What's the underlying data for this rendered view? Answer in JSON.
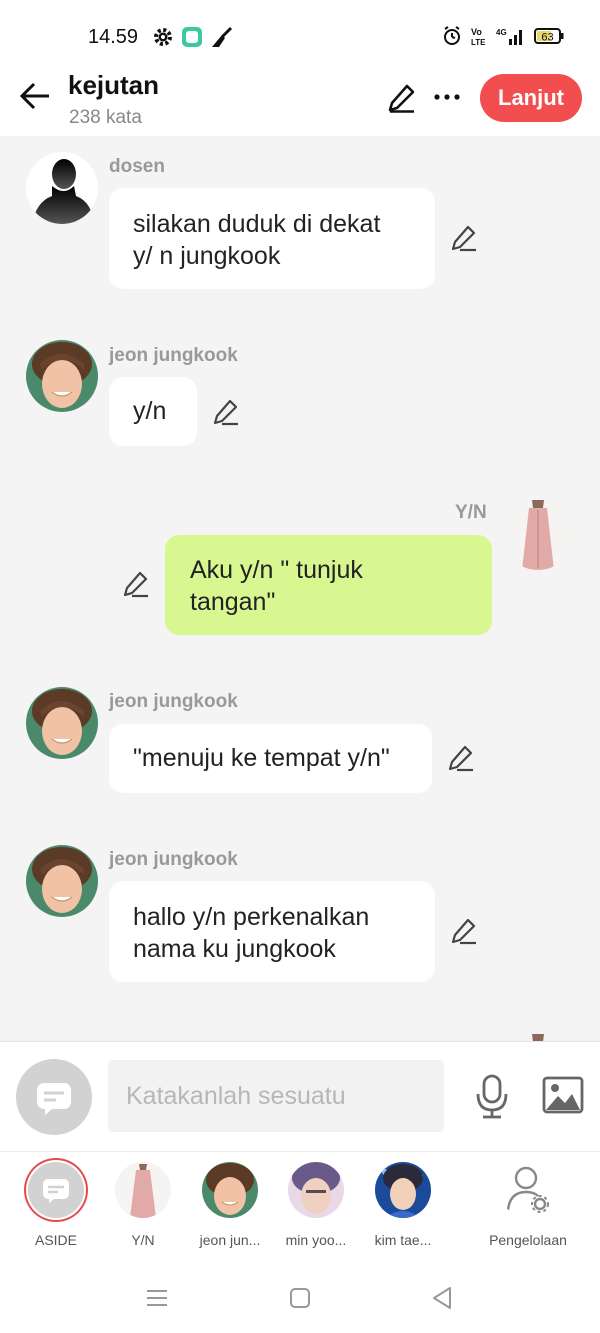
{
  "status_bar": {
    "time": "14.59",
    "battery": "63"
  },
  "header": {
    "title": "kejutan",
    "word_count": "238 kata",
    "continue_label": "Lanjut"
  },
  "messages": [
    {
      "sender": "dosen",
      "lines": [
        "silakan duduk di dekat",
        "y/  n jungkook"
      ]
    },
    {
      "sender": "jeon jungkook",
      "lines": [
        "y/n"
      ]
    },
    {
      "sender": "Y/N",
      "lines": [
        "Aku y/n \" tunjuk",
        "tangan\""
      ]
    },
    {
      "sender": "jeon jungkook",
      "lines": [
        "\"menuju ke tempat y/n\""
      ]
    },
    {
      "sender": "jeon jungkook",
      "lines": [
        "hallo y/n perkenalkan",
        "nama ku jungkook"
      ]
    }
  ],
  "input": {
    "placeholder": "Katakanlah sesuatu"
  },
  "characters": [
    {
      "label": "ASIDE"
    },
    {
      "label": "Y/N"
    },
    {
      "label": "jeon jun..."
    },
    {
      "label": "min yoo..."
    },
    {
      "label": "kim tae..."
    },
    {
      "label": "Pengelolaan"
    }
  ],
  "colors": {
    "accent": "#f24d4f",
    "my_bubble": "#d9f791",
    "background": "#f4f4f4"
  }
}
